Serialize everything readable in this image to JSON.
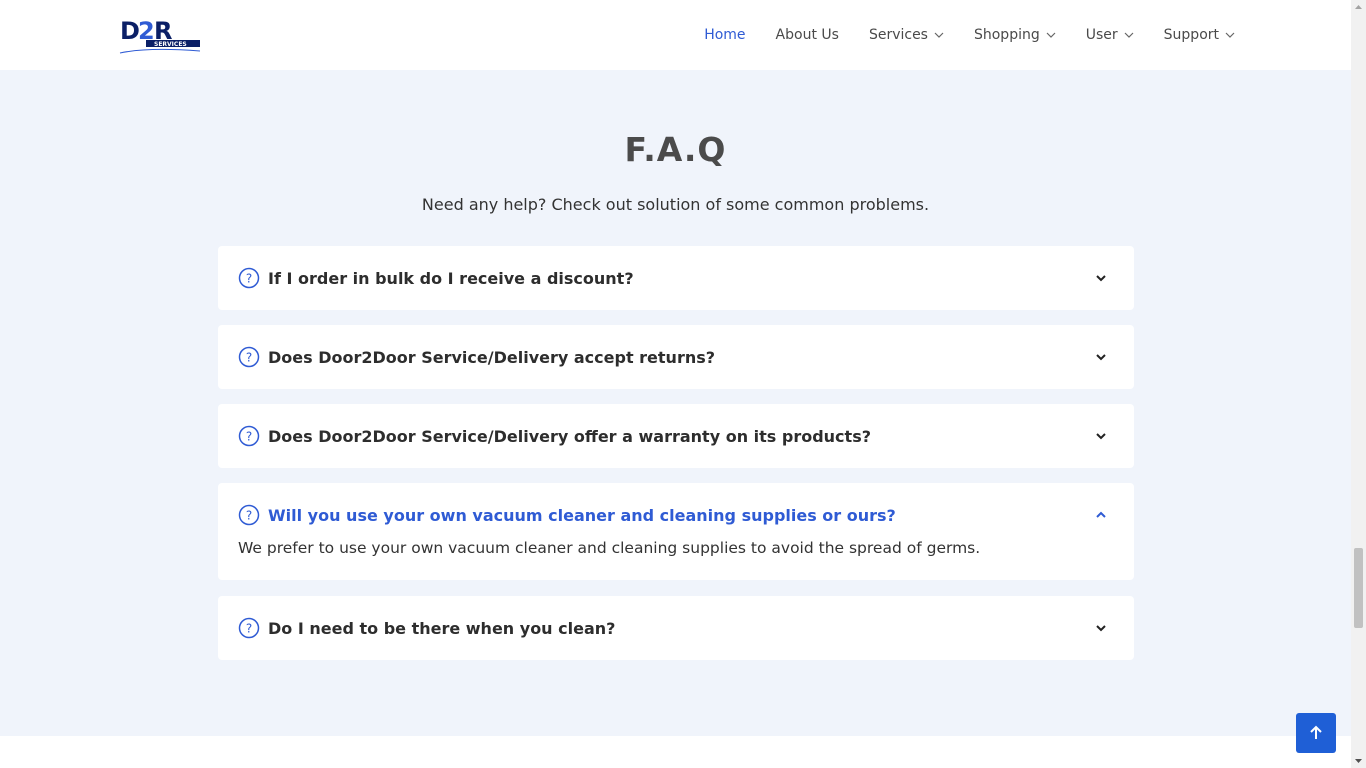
{
  "brand": {
    "logo_text": "D2R",
    "logo_sub": "SERVICES",
    "colors": {
      "primary": "#2f5bd4",
      "dark": "#0b1f66"
    }
  },
  "nav": {
    "items": [
      {
        "label": "Home",
        "active": true,
        "dropdown": false
      },
      {
        "label": "About Us",
        "active": false,
        "dropdown": false
      },
      {
        "label": "Services",
        "active": false,
        "dropdown": true
      },
      {
        "label": "Shopping",
        "active": false,
        "dropdown": true
      },
      {
        "label": "User",
        "active": false,
        "dropdown": true
      },
      {
        "label": "Support",
        "active": false,
        "dropdown": true
      }
    ]
  },
  "faq": {
    "title": "F.A.Q",
    "subtitle": "Need any help? Check out solution of some common problems.",
    "items": [
      {
        "question": "If I order in bulk do I receive a discount?",
        "open": false
      },
      {
        "question": "Does Door2Door Service/Delivery accept returns?",
        "open": false
      },
      {
        "question": "Does Door2Door Service/Delivery offer a warranty on its products?",
        "open": false
      },
      {
        "question": "Will you use your own vacuum cleaner and cleaning supplies or ours?",
        "open": true,
        "answer": "We prefer to use your own vacuum cleaner and cleaning supplies to avoid the spread of germs."
      },
      {
        "question": "Do I need to be there when you clean?",
        "open": false
      }
    ]
  },
  "icons": {
    "question": "question-circle-icon",
    "chevron_down": "chevron-down-icon",
    "chevron_up": "chevron-up-icon",
    "back_to_top": "arrow-up-icon"
  }
}
